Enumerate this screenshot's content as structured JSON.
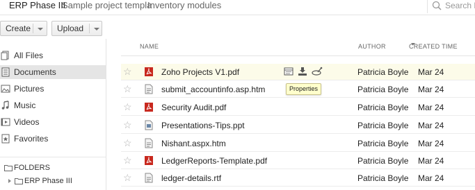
{
  "topbar": {
    "tabs": [
      {
        "label": "ERP Phase III"
      },
      {
        "label": "Sample project templa"
      },
      {
        "label": "Inventory modules"
      }
    ],
    "search_placeholder": "Search Pro"
  },
  "toolbar": {
    "create_label": "Create",
    "upload_label": "Upload"
  },
  "sidebar": {
    "items": [
      {
        "label": "All Files",
        "icon": "all-files-icon"
      },
      {
        "label": "Documents",
        "icon": "documents-icon",
        "active": true
      },
      {
        "label": "Pictures",
        "icon": "pictures-icon"
      },
      {
        "label": "Music",
        "icon": "music-icon"
      },
      {
        "label": "Videos",
        "icon": "videos-icon"
      },
      {
        "label": "Favorites",
        "icon": "favorites-icon"
      }
    ],
    "folders_label": "FOLDERS",
    "tree": [
      {
        "label": "ERP Phase III"
      }
    ]
  },
  "list": {
    "columns": {
      "name": "NAME",
      "author": "AUTHOR",
      "created": "CREATED TIME"
    },
    "rows": [
      {
        "name": "Zoho Projects V1.pdf",
        "type": "pdf",
        "author": "Patricia Boyle",
        "date": "Mar 24"
      },
      {
        "name": "submit_accountinfo.asp.htm",
        "type": "htm",
        "author": "Patricia Boyle",
        "date": "Mar 24"
      },
      {
        "name": "Security Audit.pdf",
        "type": "pdf",
        "author": "Patricia Boyle",
        "date": "Mar 24"
      },
      {
        "name": "Presentations-Tips.ppt",
        "type": "ppt",
        "author": "Patricia Boyle",
        "date": "Mar 24"
      },
      {
        "name": "Nishant.aspx.htm",
        "type": "htm",
        "author": "Patricia Boyle",
        "date": "Mar 24"
      },
      {
        "name": "LedgerReports-Template.pdf",
        "type": "pdf",
        "author": "Patricia Boyle",
        "date": "Mar 24"
      },
      {
        "name": "ledger-details.rtf",
        "type": "rtf",
        "author": "Patricia Boyle",
        "date": "Mar 24"
      }
    ]
  },
  "tooltip": {
    "text": "Properties"
  },
  "colors": {
    "highlight_row": "#fcfbe9",
    "pdf_red": "#c8281e",
    "tooltip_bg": "#ffffcc",
    "active_nav": "#e5e5e5"
  }
}
